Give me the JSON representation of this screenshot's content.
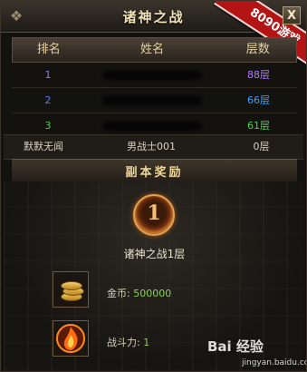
{
  "window": {
    "title": "诸神之战",
    "close_label": "X",
    "ribbon_text": "8090游戏"
  },
  "table": {
    "headers": {
      "rank": "排名",
      "name": "姓名",
      "floor": "层数"
    },
    "rows": [
      {
        "rank": "1",
        "floor": "88层",
        "color": "#8a7cff",
        "floor_color": "#b07aff"
      },
      {
        "rank": "2",
        "floor": "66层",
        "color": "#4f7fff",
        "floor_color": "#3fa0ff"
      },
      {
        "rank": "3",
        "floor": "61层",
        "color": "#57cc57",
        "floor_color": "#57cc57"
      }
    ],
    "my_row": {
      "rank": "默默无闻",
      "name": "男战士001",
      "floor": "0层"
    }
  },
  "reward": {
    "section_title": "副本奖励",
    "medal_number": "1",
    "level_text": "诸神之战1层",
    "items": [
      {
        "label": "金币:",
        "value": "500000",
        "icon": "gold-coins-icon"
      },
      {
        "label": "战斗力:",
        "value": "1",
        "icon": "combat-power-icon"
      }
    ]
  },
  "watermark": {
    "main": "Bai 经验",
    "sub": "jingyan.baidu.com"
  }
}
